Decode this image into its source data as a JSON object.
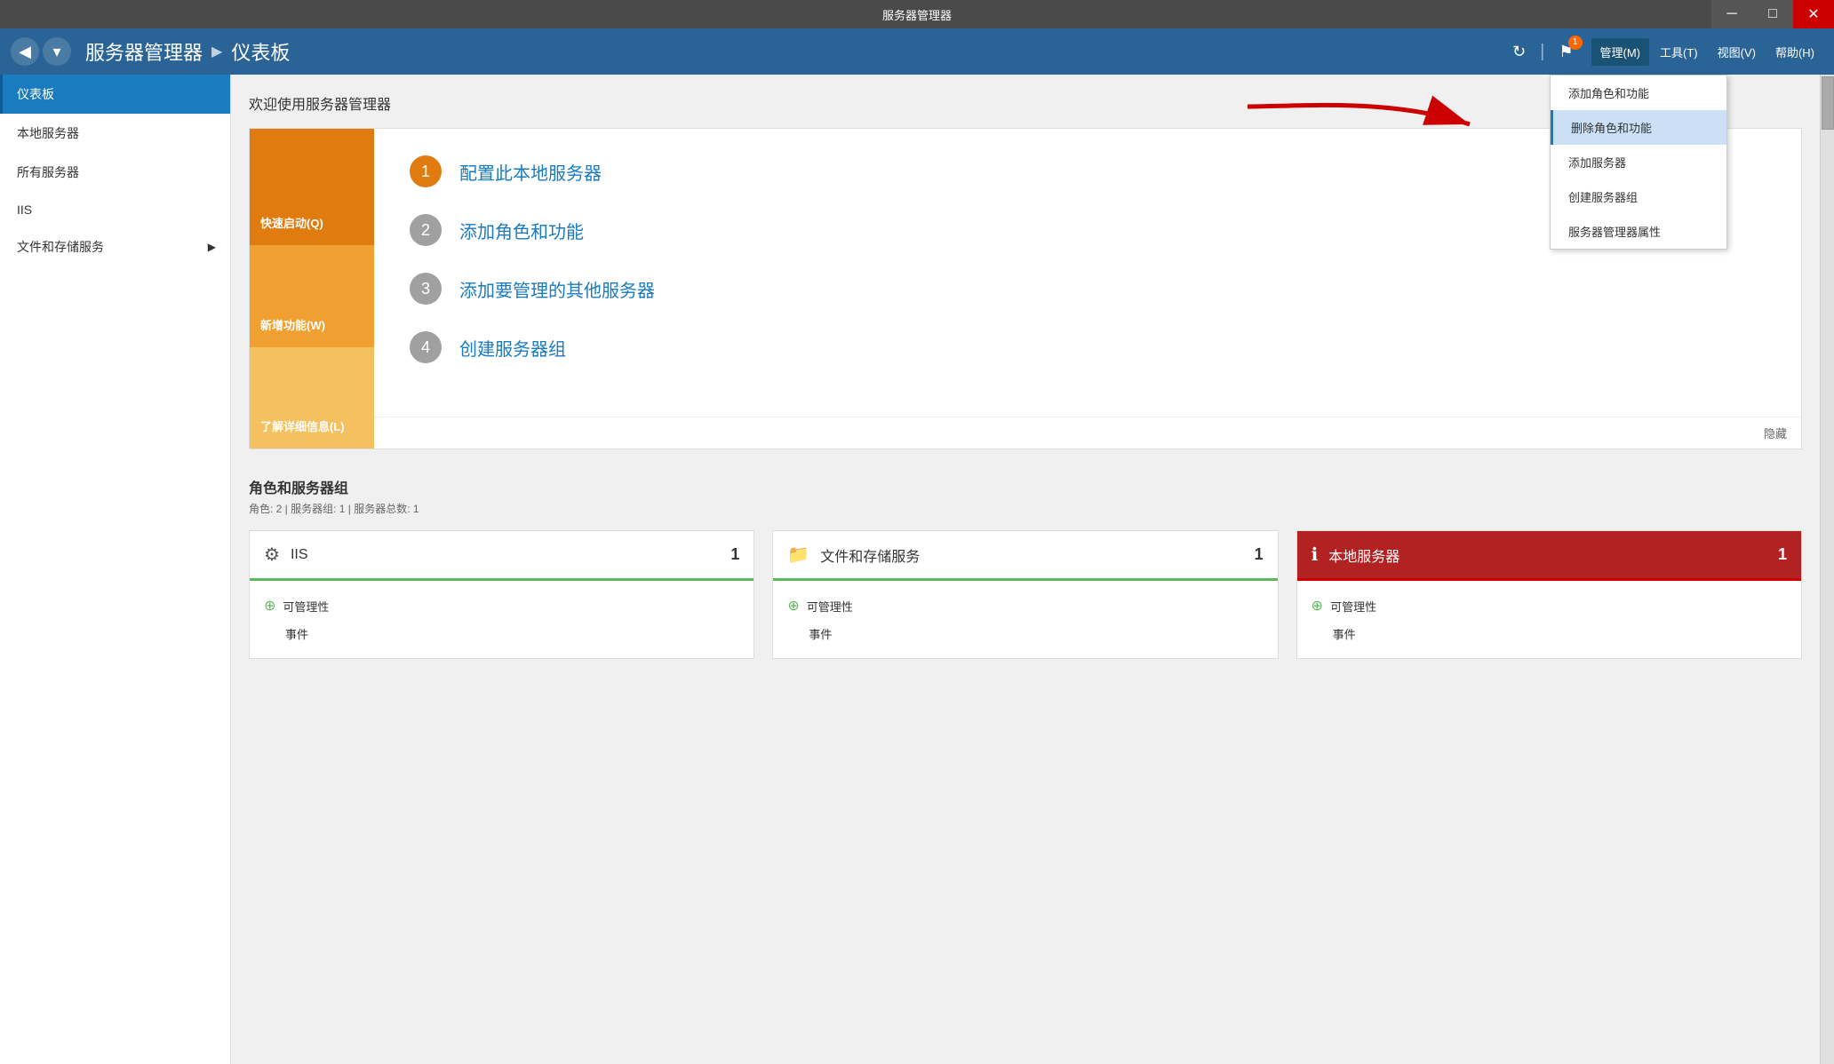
{
  "titleBar": {
    "title": "服务器管理器",
    "minLabel": "─",
    "maxLabel": "□",
    "closeLabel": "✕"
  },
  "toolbar": {
    "backLabel": "◀",
    "dropdownLabel": "▾",
    "breadcrumb": {
      "root": "服务器管理器",
      "separator": "▶",
      "current": "仪表板"
    },
    "refreshLabel": "↻",
    "separatorLabel": "|",
    "flagLabel": "⚑",
    "flagBadge": "1",
    "menus": [
      {
        "id": "manage",
        "label": "管理(M)",
        "active": true
      },
      {
        "id": "tools",
        "label": "工具(T)"
      },
      {
        "id": "view",
        "label": "视图(V)"
      },
      {
        "id": "help",
        "label": "帮助(H)"
      }
    ]
  },
  "dropdown": {
    "items": [
      {
        "id": "add-role",
        "label": "添加角色和功能",
        "highlighted": false
      },
      {
        "id": "remove-role",
        "label": "删除角色和功能",
        "highlighted": true
      },
      {
        "id": "add-server",
        "label": "添加服务器",
        "highlighted": false
      },
      {
        "id": "create-group",
        "label": "创建服务器组",
        "highlighted": false
      },
      {
        "id": "properties",
        "label": "服务器管理器属性",
        "highlighted": false
      }
    ]
  },
  "sidebar": {
    "items": [
      {
        "id": "dashboard",
        "label": "仪表板",
        "active": true,
        "hasExpand": false
      },
      {
        "id": "local-server",
        "label": "本地服务器",
        "active": false,
        "hasExpand": false
      },
      {
        "id": "all-servers",
        "label": "所有服务器",
        "active": false,
        "hasExpand": false
      },
      {
        "id": "iis",
        "label": "IIS",
        "active": false,
        "hasExpand": false
      },
      {
        "id": "file-storage",
        "label": "文件和存储服务",
        "active": false,
        "hasExpand": true
      }
    ]
  },
  "content": {
    "welcomeTitle": "欢迎使用服务器管理器",
    "quickStart": {
      "sections": [
        {
          "label": "快速启动(Q)"
        },
        {
          "label": "新增功能(W)"
        },
        {
          "label": "了解详细信息(L)"
        }
      ],
      "items": [
        {
          "number": "1",
          "label": "配置此本地服务器",
          "primary": true
        },
        {
          "number": "2",
          "label": "添加角色和功能",
          "primary": false
        },
        {
          "number": "3",
          "label": "添加要管理的其他服务器",
          "primary": false
        },
        {
          "number": "4",
          "label": "创建服务器组",
          "primary": false
        }
      ],
      "hideLabel": "隐藏"
    },
    "rolesSection": {
      "title": "角色和服务器组",
      "subtitle": "角色: 2 | 服务器组: 1 | 服务器总数: 1"
    },
    "serverCards": [
      {
        "id": "iis-card",
        "icon": "⚙",
        "name": "IIS",
        "count": "1",
        "status": "red",
        "headerRed": false,
        "rows": [
          {
            "icon": "⊕",
            "label": "可管理性"
          },
          {
            "label": "事件"
          }
        ]
      },
      {
        "id": "file-storage-card",
        "icon": "📁",
        "name": "文件和存储服务",
        "count": "1",
        "headerRed": false,
        "rows": [
          {
            "icon": "⊕",
            "label": "可管理性"
          },
          {
            "label": "事件"
          }
        ]
      },
      {
        "id": "local-server-card",
        "icon": "ℹ",
        "name": "本地服务器",
        "count": "1",
        "headerRed": true,
        "rows": [
          {
            "icon": "⊕",
            "label": "可管理性"
          },
          {
            "label": "事件"
          }
        ]
      }
    ]
  }
}
